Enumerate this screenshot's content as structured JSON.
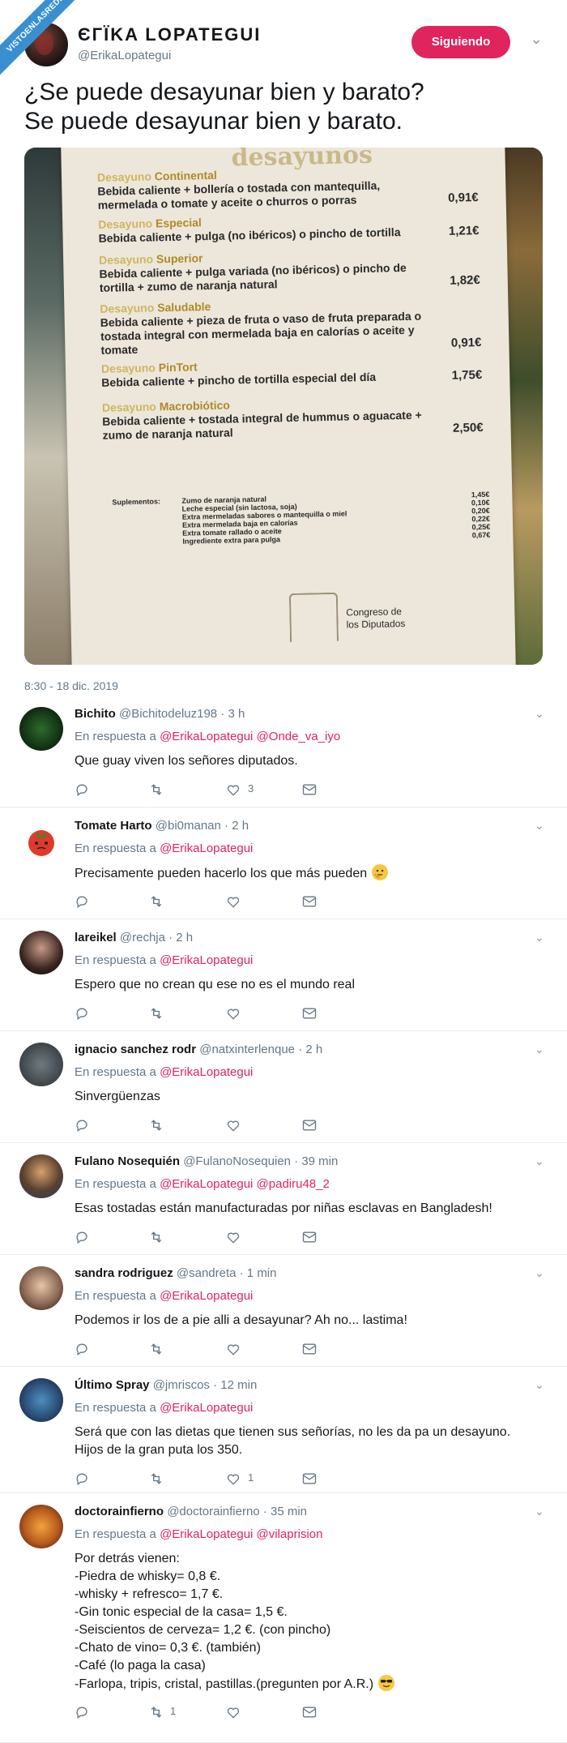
{
  "ribbon": "VISTOENLASREDES",
  "author": {
    "name": "ЄГÏKA LOPATEGUI",
    "handle": "@ErikaLopategui",
    "follow_label": "Siguiendo"
  },
  "tweet": {
    "lines": [
      "¿Se puede desayunar bien y barato?",
      "Se puede desayunar bien y barato."
    ],
    "timestamp": "8:30 - 18 dic. 2019"
  },
  "menu": {
    "heading": "desayunos",
    "items": [
      {
        "a": "Desayuno",
        "b": "Continental",
        "desc": "Bebida caliente + bollería o tostada con mantequilla, mermelada o tomate y aceite o churros o porras",
        "price": "0,91€"
      },
      {
        "a": "Desayuno",
        "b": "Especial",
        "desc": "Bebida caliente + pulga (no ibéricos) o pincho de tortilla",
        "price": "1,21€"
      },
      {
        "a": "Desayuno",
        "b": "Superior",
        "desc": "Bebida caliente + pulga variada (no ibéricos) o pincho de tortilla + zumo de naranja natural",
        "price": "1,82€"
      },
      {
        "a": "Desayuno",
        "b": "Saludable",
        "desc": "Bebida caliente + pieza de fruta o vaso de fruta preparada o tostada integral con mermelada baja en calorías o aceite y tomate",
        "price": "0,91€"
      },
      {
        "a": "Desayuno",
        "b": "PinTort",
        "desc": "Bebida caliente + pincho de tortilla especial del día",
        "price": "1,75€"
      },
      {
        "a": "Desayuno",
        "b": "Macrobiótico",
        "desc": "Bebida caliente + tostada integral de hummus o aguacate + zumo de naranja natural",
        "price": "2,50€"
      }
    ],
    "supl_title": "Suplementos:",
    "supplements": [
      {
        "label": "Zumo de naranja natural",
        "price": "1,45€"
      },
      {
        "label": "Leche especial (sin lactosa, soja)",
        "price": "0,10€"
      },
      {
        "label": "Extra mermeladas sabores o mantequilla o miel",
        "price": "0,20€"
      },
      {
        "label": "Extra mermelada baja en calorías",
        "price": "0,22€"
      },
      {
        "label": "Extra tomate rallado o aceite",
        "price": "0,25€"
      },
      {
        "label": "Ingrediente extra para pulga",
        "price": "0,67€"
      }
    ],
    "logo_text": [
      "Congreso de",
      "los Diputados"
    ]
  },
  "replies": [
    {
      "name": "Bichito",
      "handle": "@Bichitodeluz198 · 3 h",
      "resp_prefix": "En respuesta a",
      "mentions": "@ErikaLopategui @Onde_va_iyo",
      "body": [
        "Que guay viven los señores diputados."
      ],
      "likes": "3",
      "retweets": ""
    },
    {
      "name": "Tomate Harto",
      "handle": "@bi0manan · 2 h",
      "resp_prefix": "En respuesta a",
      "mentions": "@ErikaLopategui",
      "body": [
        "Precisamente pueden hacerlo los que más pueden"
      ],
      "likes": "",
      "retweets": ""
    },
    {
      "name": "lareikel",
      "handle": "@rechja · 2 h",
      "resp_prefix": "En respuesta a",
      "mentions": "@ErikaLopategui",
      "body": [
        "Espero que no crean qu ese no es el mundo real"
      ],
      "likes": "",
      "retweets": ""
    },
    {
      "name": "ignacio sanchez rodr",
      "handle": "@natxinterlenque · 2 h",
      "resp_prefix": "En respuesta a",
      "mentions": "@ErikaLopategui",
      "body": [
        "Sinvergüenzas"
      ],
      "likes": "",
      "retweets": ""
    },
    {
      "name": "Fulano Nosequién",
      "handle": "@FulanoNosequien · 39 min",
      "resp_prefix": "En respuesta a",
      "mentions": "@ErikaLopategui @padiru48_2",
      "body": [
        "Esas tostadas están manufacturadas por niñas esclavas en Bangladesh!"
      ],
      "likes": "",
      "retweets": ""
    },
    {
      "name": "sandra rodriguez",
      "handle": "@sandreta · 1 min",
      "resp_prefix": "En respuesta a",
      "mentions": "@ErikaLopategui",
      "body": [
        "Podemos ir los de a pie alli a desayunar? Ah no... lastima!"
      ],
      "likes": "",
      "retweets": ""
    },
    {
      "name": "Último Spray",
      "handle": "@jmriscos · 12 min",
      "resp_prefix": "En respuesta a",
      "mentions": "@ErikaLopategui",
      "body": [
        "Será que con las dietas que tienen sus señorías, no les da pa un desayuno.",
        "Hijos de la gran puta los 350."
      ],
      "likes": "1",
      "retweets": ""
    },
    {
      "name": "doctorainfierno",
      "handle": "@doctorainfierno · 35 min",
      "resp_prefix": "En respuesta a",
      "mentions": "@ErikaLopategui @vilaprision",
      "body": [
        "Por detrás vienen:",
        "-Piedra de whisky= 0,8 €.",
        "-whisky + refresco= 1,7 €.",
        "-Gin tonic especial de la casa= 1,5 €.",
        "-Seiscientos de cerveza= 1,2 €. (con pincho)",
        "-Chato de vino= 0,3 €. (también)",
        "-Café (lo paga la casa)",
        "-Farlopa, tripis, cristal, pastillas.(pregunten por A.R.)"
      ],
      "likes": "",
      "retweets": "1"
    }
  ],
  "colors": {
    "accent": "#e0245e",
    "muted": "#657786",
    "divider": "#e6ecf0"
  },
  "icons": [
    "reply-icon",
    "retweet-icon",
    "like-icon",
    "message-icon",
    "chevron-down-icon"
  ]
}
